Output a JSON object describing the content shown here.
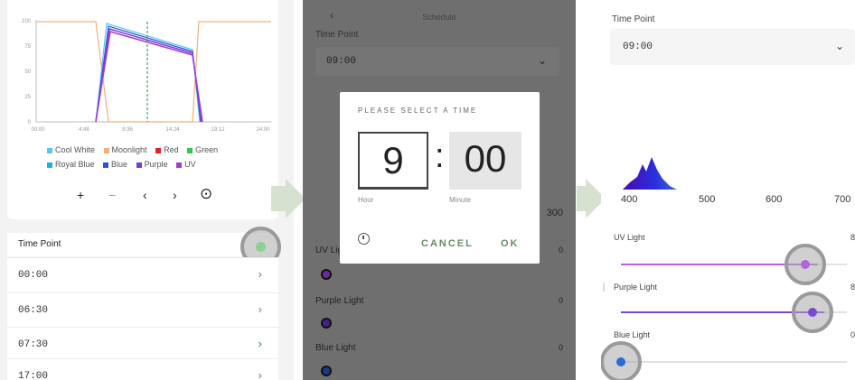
{
  "panel1": {
    "chart": {
      "yticks": [
        "100",
        "75",
        "50",
        "25",
        "0"
      ],
      "xticks": [
        "00:00",
        "4:48",
        "9:36",
        "14:24",
        "19:12",
        "24:00"
      ]
    },
    "legend": [
      {
        "label": "Cool White",
        "color": "#56c6ea"
      },
      {
        "label": "Moonlight",
        "color": "#f3b07d"
      },
      {
        "label": "Red",
        "color": "#e42222"
      },
      {
        "label": "Green",
        "color": "#2ec94a"
      },
      {
        "label": "Royal Blue",
        "color": "#1faee5"
      },
      {
        "label": "Blue",
        "color": "#2a52d6"
      },
      {
        "label": "Purple",
        "color": "#7a3ed4"
      },
      {
        "label": "UV",
        "color": "#a23bd9"
      }
    ],
    "controls": [
      "+",
      "−",
      "‹",
      "›",
      "⊙"
    ],
    "time_point_title": "Time Point",
    "time_points": [
      "00:00",
      "06:30",
      "07:30",
      "17:00"
    ],
    "row_chevron": "›"
  },
  "panel2": {
    "header_title": "Schedule",
    "back": "‹",
    "field_label": "Time Point",
    "field_value": "09:00",
    "chevron": "⌄",
    "dialog": {
      "title": "PLEASE SELECT A TIME",
      "hour": "9",
      "colon": ":",
      "minute": "00",
      "hour_caption": "Hour",
      "minute_caption": "Minute",
      "cancel": "CANCEL",
      "ok": "OK"
    },
    "right_edge_number": "300",
    "lights": [
      {
        "label": "UV Light",
        "value": "0"
      },
      {
        "label": "Purple Light",
        "value": "0"
      },
      {
        "label": "Blue Light",
        "value": "0"
      }
    ]
  },
  "panel3": {
    "field_label": "Time Point",
    "field_value": "09:00",
    "chevron": "⌄",
    "spectrum_ticks": [
      "400",
      "500",
      "600",
      "700"
    ],
    "sliders": [
      {
        "label": "UV Light",
        "value": "8",
        "level": 0.87,
        "color": "#b066d9"
      },
      {
        "label": "Purple Light",
        "value": "8",
        "level": 0.9,
        "color": "#7a48d8"
      },
      {
        "label": "Blue Light",
        "value": "0",
        "level": 0.0,
        "color": "#2a6bd8"
      }
    ]
  }
}
